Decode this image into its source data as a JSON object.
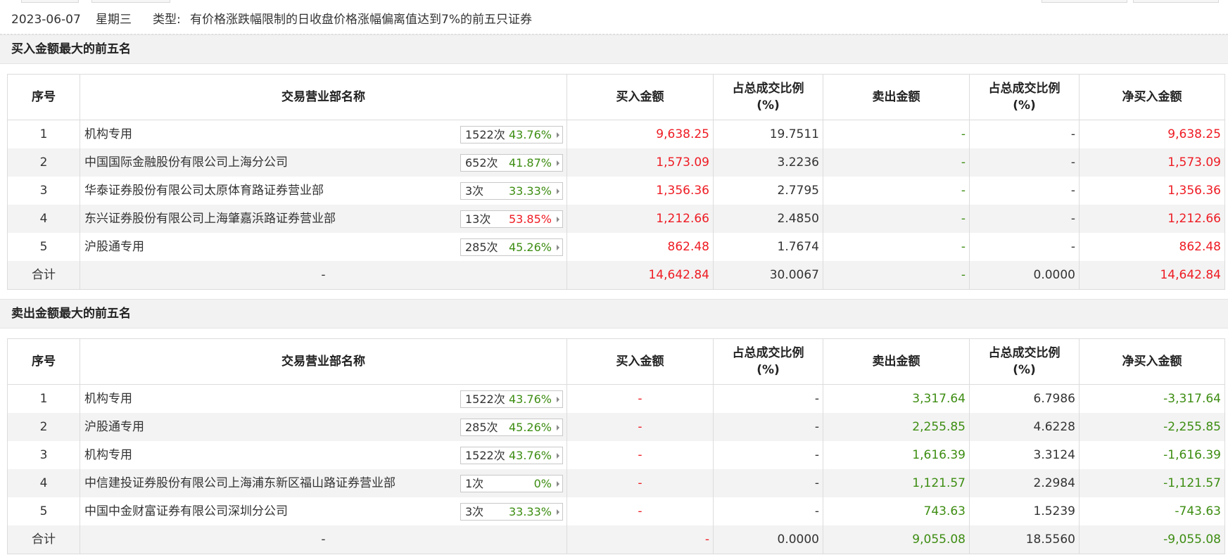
{
  "info": {
    "date": "2023-06-07",
    "weekday": "星期三",
    "type_label": "类型:",
    "type_text": "有价格涨跌幅限制的日收盘价格涨幅偏离值达到7%的前五只证券"
  },
  "colors": {
    "up": "#ee1b23",
    "down": "#3d8d12"
  },
  "headers": {
    "idx": "序号",
    "name": "交易营业部名称",
    "buy": "买入金额",
    "ratio_top": "占总成交比例",
    "ratio_unit": "(%)",
    "sell": "卖出金额",
    "net": "净买入金额"
  },
  "buy": {
    "title": "买入金额最大的前五名",
    "rows": [
      {
        "idx": "1",
        "name": "机构专用",
        "count": "1522次",
        "pct": "43.76%",
        "pct_color": "green",
        "buy": "9,638.25",
        "buy_ratio": "19.7511",
        "sell": "-",
        "sell_ratio": "-",
        "net": "9,638.25"
      },
      {
        "idx": "2",
        "name": "中国国际金融股份有限公司上海分公司",
        "count": "652次",
        "pct": "41.87%",
        "pct_color": "green",
        "buy": "1,573.09",
        "buy_ratio": "3.2236",
        "sell": "-",
        "sell_ratio": "-",
        "net": "1,573.09"
      },
      {
        "idx": "3",
        "name": "华泰证券股份有限公司太原体育路证券营业部",
        "count": "3次",
        "pct": "33.33%",
        "pct_color": "green",
        "buy": "1,356.36",
        "buy_ratio": "2.7795",
        "sell": "-",
        "sell_ratio": "-",
        "net": "1,356.36"
      },
      {
        "idx": "4",
        "name": "东兴证券股份有限公司上海肇嘉浜路证券营业部",
        "count": "13次",
        "pct": "53.85%",
        "pct_color": "red",
        "buy": "1,212.66",
        "buy_ratio": "2.4850",
        "sell": "-",
        "sell_ratio": "-",
        "net": "1,212.66"
      },
      {
        "idx": "5",
        "name": "沪股通专用",
        "count": "285次",
        "pct": "45.26%",
        "pct_color": "green",
        "buy": "862.48",
        "buy_ratio": "1.7674",
        "sell": "-",
        "sell_ratio": "-",
        "net": "862.48"
      }
    ],
    "total": {
      "label": "合计",
      "name": "-",
      "buy": "14,642.84",
      "buy_ratio": "30.0067",
      "sell": "-",
      "sell_ratio": "0.0000",
      "net": "14,642.84"
    }
  },
  "sell": {
    "title": "卖出金额最大的前五名",
    "rows": [
      {
        "idx": "1",
        "name": "机构专用",
        "count": "1522次",
        "pct": "43.76%",
        "pct_color": "green",
        "buy": "-",
        "buy_ratio": "-",
        "sell": "3,317.64",
        "sell_ratio": "6.7986",
        "net": "-3,317.64"
      },
      {
        "idx": "2",
        "name": "沪股通专用",
        "count": "285次",
        "pct": "45.26%",
        "pct_color": "green",
        "buy": "-",
        "buy_ratio": "-",
        "sell": "2,255.85",
        "sell_ratio": "4.6228",
        "net": "-2,255.85"
      },
      {
        "idx": "3",
        "name": "机构专用",
        "count": "1522次",
        "pct": "43.76%",
        "pct_color": "green",
        "buy": "-",
        "buy_ratio": "-",
        "sell": "1,616.39",
        "sell_ratio": "3.3124",
        "net": "-1,616.39"
      },
      {
        "idx": "4",
        "name": "中信建投证券股份有限公司上海浦东新区福山路证券营业部",
        "count": "1次",
        "pct": "0%",
        "pct_color": "green",
        "buy": "-",
        "buy_ratio": "-",
        "sell": "1,121.57",
        "sell_ratio": "2.2984",
        "net": "-1,121.57"
      },
      {
        "idx": "5",
        "name": "中国中金财富证券有限公司深圳分公司",
        "count": "3次",
        "pct": "33.33%",
        "pct_color": "green",
        "buy": "-",
        "buy_ratio": "-",
        "sell": "743.63",
        "sell_ratio": "1.5239",
        "net": "-743.63"
      }
    ],
    "total": {
      "label": "合计",
      "name": "-",
      "buy": "-",
      "buy_ratio": "0.0000",
      "sell": "9,055.08",
      "sell_ratio": "18.5560",
      "net": "-9,055.08"
    }
  }
}
